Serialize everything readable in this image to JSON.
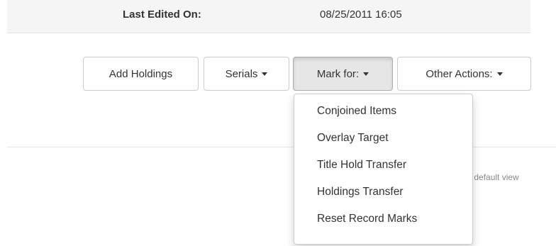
{
  "info": {
    "label": "Last Edited On:",
    "value": "08/25/2011 16:05"
  },
  "toolbar": {
    "add_holdings": "Add Holdings",
    "serials": "Serials",
    "mark_for": "Mark for:",
    "other_actions": "Other Actions:"
  },
  "mark_for_menu": {
    "items": [
      "Conjoined Items",
      "Overlay Target",
      "Title Hold Transfer",
      "Holdings Transfer",
      "Reset Record Marks"
    ]
  },
  "background": {
    "partial_text": "et default view"
  },
  "icons": {
    "dropdown_caret": "caret-down-icon"
  }
}
